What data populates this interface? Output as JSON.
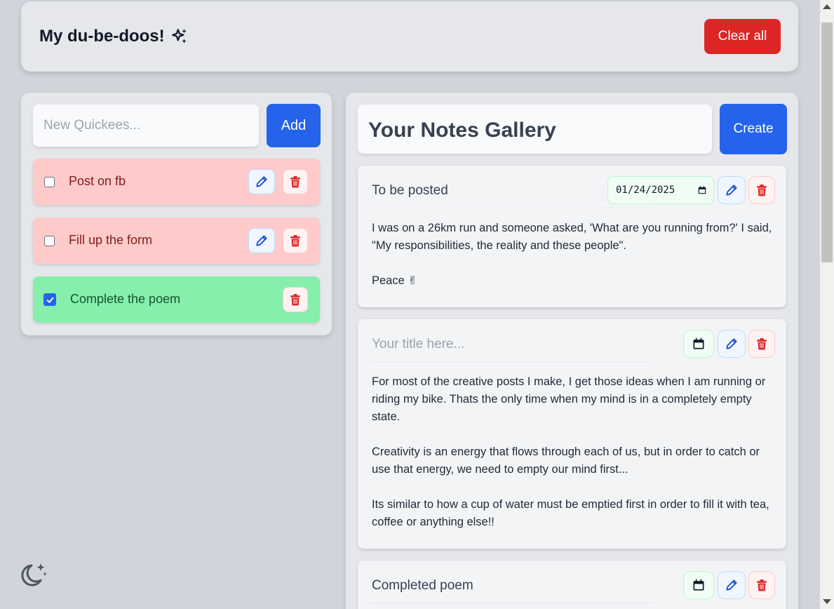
{
  "header": {
    "title": "My du-be-doos!",
    "title_icon": "sparkles-icon",
    "clear_label": "Clear all"
  },
  "quick": {
    "placeholder": "New Quickees...",
    "add_label": "Add",
    "items": [
      {
        "text": "Post on fb",
        "checked": false
      },
      {
        "text": "Fill up the form",
        "checked": false
      },
      {
        "text": "Complete the poem",
        "checked": true
      }
    ]
  },
  "gallery": {
    "title": "Your Notes Gallery",
    "create_label": "Create",
    "notes": [
      {
        "title": "To be posted",
        "date": "01/24/2025",
        "body": "I was on a 26km run and someone asked, 'What are you running from?' I said, \"My responsibilities, the reality and these people\".\n\nPeace ✌"
      },
      {
        "title": "",
        "title_placeholder": "Your title here...",
        "date": "",
        "body": "For most of the creative posts I make, I get those ideas when I am running or riding my bike. Thats the only time when my mind is in a completely empty state.\n\nCreativity is an energy that flows through each of us, but in order to catch or use that energy, we need to empty our mind first...\n\nIts similar to how a cup of water must be emptied first in order to fill it with tea, coffee or anything else!!"
      },
      {
        "title": "Completed poem",
        "date": "",
        "body": ""
      }
    ]
  },
  "colors": {
    "accent": "#2563eb",
    "danger": "#dc2626",
    "pending_bg": "#fecaca",
    "done_bg": "#86efac"
  }
}
